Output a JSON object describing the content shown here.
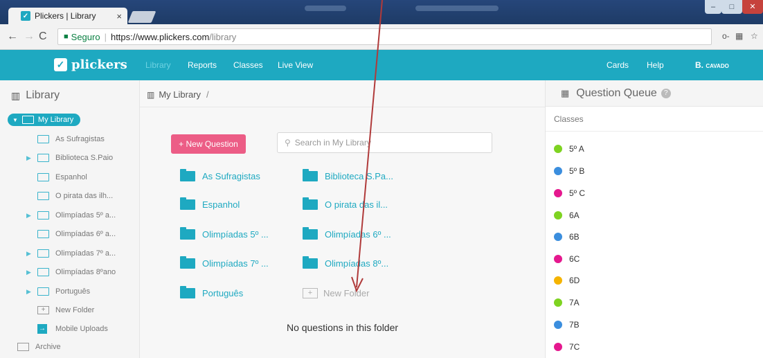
{
  "browser": {
    "tab_title": "Plickers | Library",
    "tab_close": "×",
    "secure_label": "Seguro",
    "url_host": "https://www.plickers.com",
    "url_path": "/library"
  },
  "appbar": {
    "logo_text": "plickers",
    "nav": [
      "Library",
      "Reports",
      "Classes",
      "Live View"
    ],
    "active_nav": "Library",
    "cards": "Cards",
    "help": "Help",
    "user": "B. cavado"
  },
  "sidebar": {
    "title": "Library",
    "root_label": "My Library",
    "items": [
      {
        "label": "As Sufragistas",
        "expandable": false
      },
      {
        "label": "Biblioteca S.Paio",
        "expandable": true
      },
      {
        "label": "Espanhol",
        "expandable": false
      },
      {
        "label": "O pirata das ilh...",
        "expandable": false
      },
      {
        "label": "Olimpíadas 5º a...",
        "expandable": true
      },
      {
        "label": "Olimpíadas 6º a...",
        "expandable": false
      },
      {
        "label": "Olimpíadas 7º a...",
        "expandable": true
      },
      {
        "label": "Olimpíadas 8ºano",
        "expandable": true
      },
      {
        "label": "Português",
        "expandable": true
      }
    ],
    "new_folder": "New Folder",
    "mobile_uploads": "Mobile Uploads",
    "archive": "Archive"
  },
  "main": {
    "breadcrumb": "My Library",
    "breadcrumb_sep": "/",
    "new_question": "+ New Question",
    "search_placeholder": "Search in My Library",
    "folders_left": [
      "As Sufragistas",
      "Espanhol",
      "Olimpíadas 5º ...",
      "Olimpíadas 7º ...",
      "Português"
    ],
    "folders_right": [
      "Biblioteca S.Pa...",
      "O pirata das il...",
      "Olimpíadas 6º ...",
      "Olimpíadas 8º..."
    ],
    "new_folder": "New Folder",
    "empty_message": "No questions in this folder"
  },
  "queue": {
    "title": "Question Queue",
    "classes_label": "Classes",
    "classes": [
      {
        "name": "5º A",
        "color": "#7ed321"
      },
      {
        "name": "5º B",
        "color": "#3b8ede"
      },
      {
        "name": "5º C",
        "color": "#e5188e"
      },
      {
        "name": "6A",
        "color": "#7ed321"
      },
      {
        "name": "6B",
        "color": "#3b8ede"
      },
      {
        "name": "6C",
        "color": "#e5188e"
      },
      {
        "name": "6D",
        "color": "#f5b400"
      },
      {
        "name": "7A",
        "color": "#7ed321"
      },
      {
        "name": "7B",
        "color": "#3b8ede"
      },
      {
        "name": "7C",
        "color": "#e5188e"
      }
    ]
  },
  "colors": {
    "brand": "#1ea9c1",
    "new_question": "#ec5d86",
    "arrow": "#b03a3a"
  }
}
